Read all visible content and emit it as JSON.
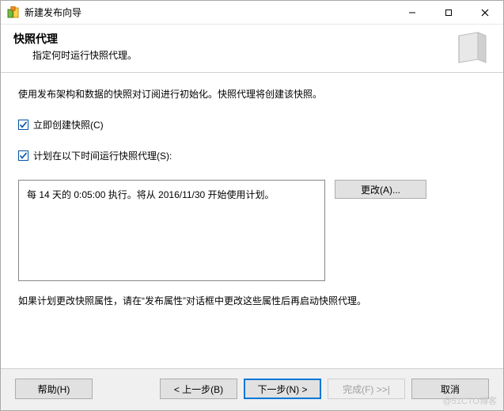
{
  "window": {
    "title": "新建发布向导"
  },
  "header": {
    "title": "快照代理",
    "subtitle": "指定何时运行快照代理。"
  },
  "content": {
    "intro": "使用发布架构和数据的快照对订阅进行初始化。快照代理将创建该快照。",
    "checkbox1_label": "立即创建快照(C)",
    "checkbox1_checked": true,
    "checkbox2_label": "计划在以下时间运行快照代理(S):",
    "checkbox2_checked": true,
    "schedule_text": "每 14 天的 0:05:00 执行。将从 2016/11/30 开始使用计划。",
    "change_button": "更改(A)...",
    "note": "如果计划更改快照属性，请在“发布属性”对话框中更改这些属性后再启动快照代理。"
  },
  "footer": {
    "help": "帮助(H)",
    "back": "< 上一步(B)",
    "next": "下一步(N) >",
    "finish": "完成(F) >>|",
    "cancel": "取消"
  },
  "watermark": "@51CTO博客"
}
